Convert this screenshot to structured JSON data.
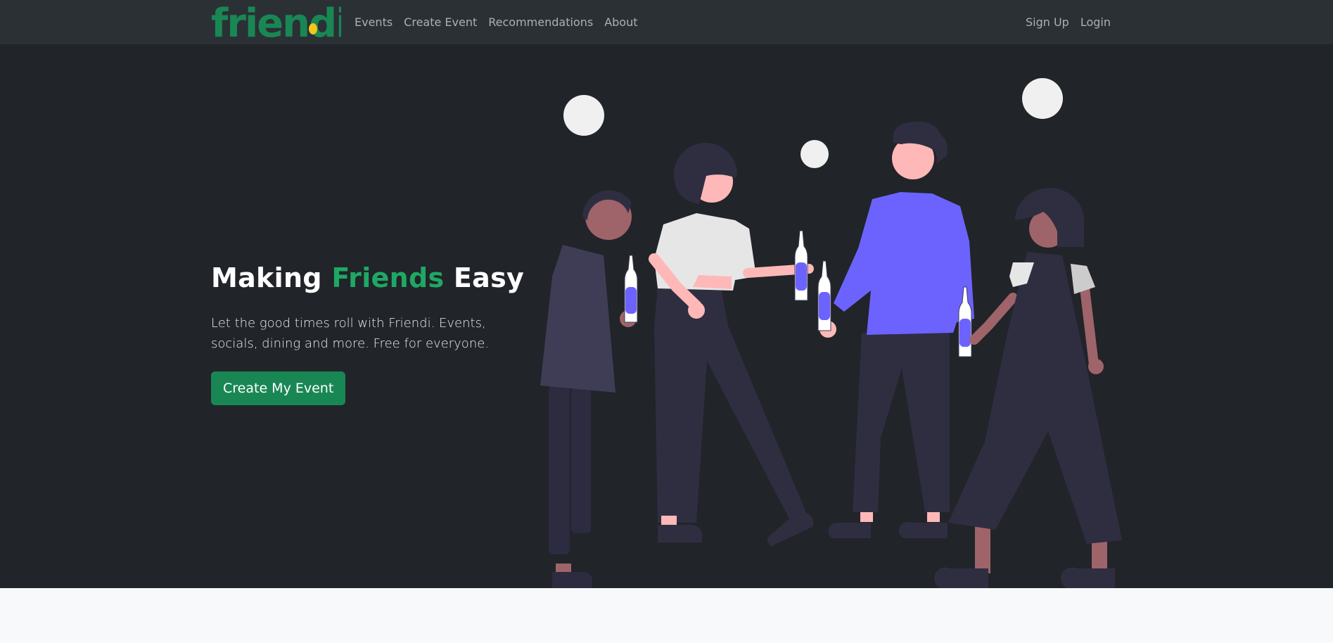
{
  "brand": {
    "name": "friendi",
    "color": "#198754",
    "dot_color": "#f5c518"
  },
  "nav": {
    "left": [
      {
        "label": "Events"
      },
      {
        "label": "Create Event"
      },
      {
        "label": "Recommendations"
      },
      {
        "label": "About"
      }
    ],
    "right": [
      {
        "label": "Sign Up"
      },
      {
        "label": "Login"
      }
    ]
  },
  "hero": {
    "title_part1": "Making ",
    "title_highlight": "Friends",
    "title_part2": " Easy",
    "description": "Let the good times roll with Friendi. Events, socials, dining and more. Free for everyone.",
    "cta_label": "Create My Event",
    "accent_color": "#1ea864",
    "background": "#212429",
    "illustration": "friends-celebrating-illustration"
  }
}
